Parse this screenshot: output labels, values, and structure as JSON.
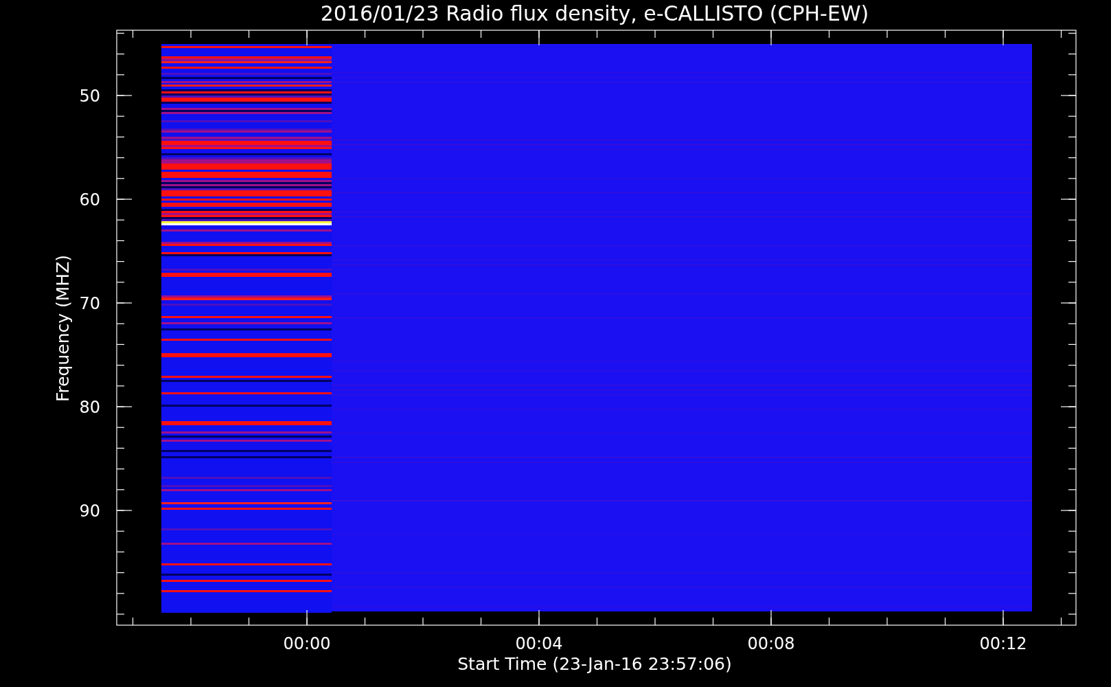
{
  "title": "2016/01/23  Radio flux density, e-CALLISTO (CPH-EW)",
  "y_axis": {
    "label": "Frequency (MHZ)",
    "ticks": [
      "50",
      "60",
      "70",
      "80",
      "90"
    ]
  },
  "x_axis": {
    "label": "Start Time (23-Jan-16 23:57:06)",
    "ticks": [
      "00:00",
      "00:04",
      "00:08",
      "00:12"
    ]
  }
}
